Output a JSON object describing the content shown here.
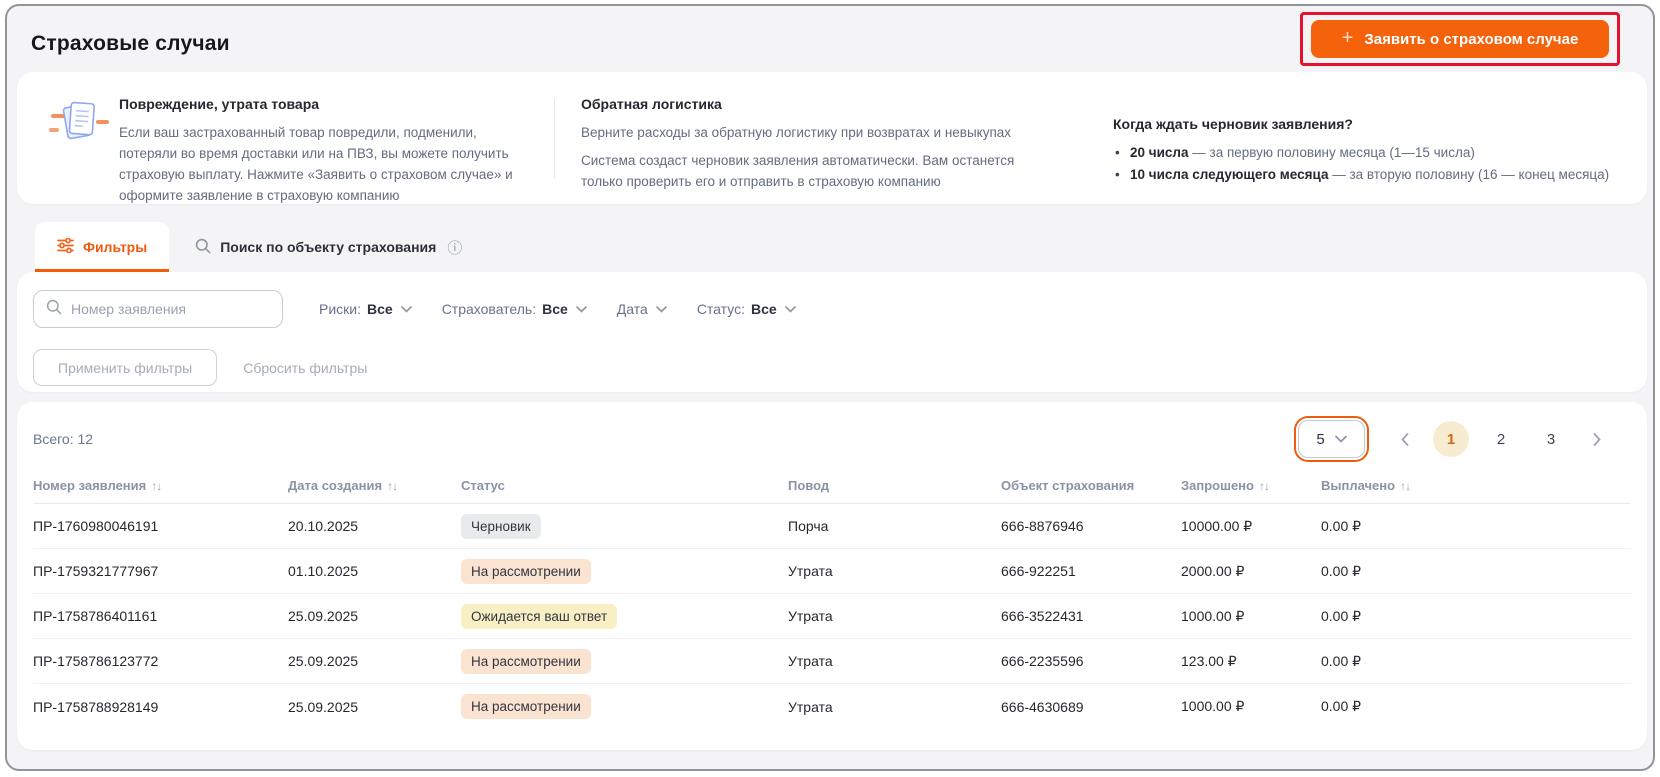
{
  "page": {
    "title": "Страховые случаи"
  },
  "header": {
    "claim_button": "Заявить о страховом случае",
    "plus": "+"
  },
  "info_panel": {
    "damage": {
      "title": "Повреждение, утрата товара",
      "text": "Если ваш застрахованный товар повредили, подменили, потеряли во время доставки или на ПВЗ, вы можете получить страховую выплату. Нажмите «Заявить о страховом случае» и оформите заявление в страховую компанию"
    },
    "logistics": {
      "title": "Обратная логистика",
      "p1": "Верните расходы за обратную логистику при возвратах и невыкупах",
      "p2": "Система создаст черновик заявления автоматически. Вам останется только проверить его и отправить в страховую компанию"
    },
    "draft_schedule": {
      "title": "Когда ждать черновик заявления?",
      "bullets": [
        {
          "bold": "20 числа",
          "rest": " — за первую половину месяца (1—15 числа)"
        },
        {
          "bold": "10 числа следующего месяца",
          "rest": " — за вторую половину (16 — конец месяца)"
        }
      ]
    }
  },
  "tabs": [
    {
      "label": "Фильтры",
      "active": true
    },
    {
      "label": "Поиск по объекту страхования",
      "active": false
    }
  ],
  "filters": {
    "search_placeholder": "Номер заявления",
    "dropdowns": [
      {
        "label": "Риски:",
        "value": "Все"
      },
      {
        "label": "Страхователь:",
        "value": "Все"
      },
      {
        "label": "Дата",
        "value": ""
      },
      {
        "label": "Статус:",
        "value": "Все"
      }
    ],
    "apply_label": "Применить фильтры",
    "reset_label": "Сбросить фильтры"
  },
  "table": {
    "total_label": "Всего: 12",
    "pagination": {
      "page_size": "5",
      "pages": [
        "1",
        "2",
        "3"
      ]
    },
    "columns": [
      {
        "label": "Номер заявления",
        "sortable": true
      },
      {
        "label": "Дата создания",
        "sortable": true
      },
      {
        "label": "Статус",
        "sortable": false
      },
      {
        "label": "Повод",
        "sortable": false
      },
      {
        "label": "Объект страхования",
        "sortable": false
      },
      {
        "label": "Запрошено",
        "sortable": true
      },
      {
        "label": "Выплачено",
        "sortable": true
      }
    ],
    "rows": [
      {
        "number": "ПР-1760980046191",
        "date": "20.10.2025",
        "status": "Черновик",
        "status_type": "draft",
        "reason": "Порча",
        "object": "666-8876946",
        "requested": "10000.00 ₽",
        "paid": "0.00 ₽"
      },
      {
        "number": "ПР-1759321777967",
        "date": "01.10.2025",
        "status": "На рассмотрении",
        "status_type": "review",
        "reason": "Утрата",
        "object": "666-922251",
        "requested": "2000.00 ₽",
        "paid": "0.00 ₽"
      },
      {
        "number": "ПР-1758786401161",
        "date": "25.09.2025",
        "status": "Ожидается ваш ответ",
        "status_type": "awaiting",
        "reason": "Утрата",
        "object": "666-3522431",
        "requested": "1000.00 ₽",
        "paid": "0.00 ₽"
      },
      {
        "number": "ПР-1758786123772",
        "date": "25.09.2025",
        "status": "На рассмотрении",
        "status_type": "review",
        "reason": "Утрата",
        "object": "666-2235596",
        "requested": "123.00 ₽",
        "paid": "0.00 ₽"
      },
      {
        "number": "ПР-1758788928149",
        "date": "25.09.2025",
        "status": "На рассмотрении",
        "status_type": "review",
        "reason": "Утрата",
        "object": "666-4630689",
        "requested": "1000.00 ₽",
        "paid": "0.00 ₽"
      }
    ]
  },
  "colors": {
    "accent_orange": "#f5620c",
    "annotation_red": "#e5132e",
    "tab_active": "#ef5b0d",
    "badge_draft_bg": "#e9eaec",
    "badge_review_bg": "#fbe3d2",
    "badge_awaiting_bg": "#f8efc4",
    "active_page_bg": "#f7ecd0",
    "active_page_text": "#d2690e"
  },
  "icons": {
    "plus": "plus-icon",
    "documents": "documents-icon",
    "filter": "filter-sliders-icon",
    "search": "search-icon",
    "info": "info-icon",
    "chevron": "chevron-down-icon",
    "sort": "sort-arrows-icon"
  }
}
